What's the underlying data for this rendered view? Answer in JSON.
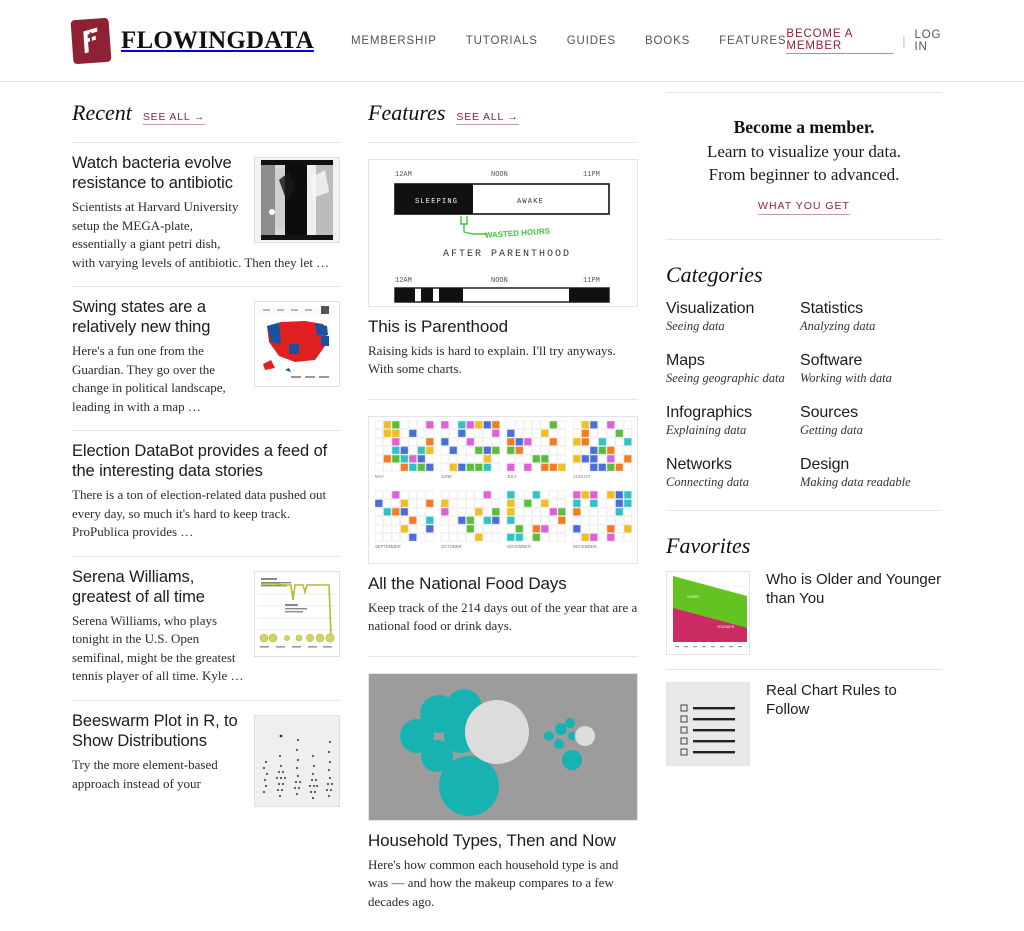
{
  "header": {
    "brand_name": "FLOWINGDATA",
    "logo_icon": "flowingdata-logo-icon",
    "nav": [
      {
        "label": "MEMBERSHIP"
      },
      {
        "label": "TUTORIALS"
      },
      {
        "label": "GUIDES"
      },
      {
        "label": "BOOKS"
      },
      {
        "label": "FEATURES"
      }
    ],
    "become_member": "BECOME A MEMBER",
    "separator": "|",
    "log_in": "LOG IN",
    "accent_color": "#8e2233"
  },
  "recent": {
    "title": "Recent",
    "see_all": "SEE ALL →",
    "posts": [
      {
        "title": "Watch bacteria evolve resistance to antibiotic",
        "excerpt": "Scientists at Harvard University setup the MEGA-plate, essentially a giant petri dish, with varying levels of antibiotic. Then they let …",
        "thumb": "bacteria-petri-photo"
      },
      {
        "title": "Swing states are a relatively new thing",
        "excerpt": "Here's a fun one from the Guardian. They go over the change in political landscape, leading in with a map …",
        "thumb": "us-election-map"
      },
      {
        "title": "Election DataBot provides a feed of the interesting data stories",
        "excerpt": "There is a ton of election-related data pushed out every day, so much it's hard to keep track. ProPublica provides …",
        "thumb": null
      },
      {
        "title": "Serena Williams, greatest of all time",
        "excerpt": "Serena Williams, who plays tonight in the U.S. Open semifinal, might be the greatest tennis player of all time. Kyle …",
        "thumb": "tennis-ranking-line-chart"
      },
      {
        "title": "Beeswarm Plot in R, to Show Distributions",
        "excerpt": "Try the more element-based approach instead of your",
        "thumb": "beeswarm-plot"
      }
    ]
  },
  "features": {
    "title": "Features",
    "see_all": "SEE ALL →",
    "items": [
      {
        "title": "This is Parenthood",
        "excerpt": "Raising kids is hard to explain. I'll try anyways. With some charts.",
        "image": {
          "name": "parenthood-timeline-chart",
          "labels": [
            "12AM",
            "NOON",
            "11PM",
            "SLEEPING",
            "AWAKE",
            "WASTED HOURS",
            "AFTER PARENTHOOD",
            "12AM",
            "NOON",
            "11PM"
          ],
          "annotation_color": "#3ec63e"
        }
      },
      {
        "title": "All the National Food Days",
        "excerpt": "Keep track of the 214 days out of the year that are a national food or drink days.",
        "image": {
          "name": "national-food-days-calendar-heatmap",
          "months": [
            "MAY",
            "JUNE",
            "JULY",
            "AUGUST",
            "SEPTEMBER",
            "OCTOBER",
            "NOVEMBER",
            "DECEMBER"
          ],
          "colors": [
            "#2ec4c6",
            "#f47c20",
            "#5bbd3a",
            "#e060d8",
            "#f0c020",
            "#4a6fd8"
          ]
        }
      },
      {
        "title": "Household Types, Then and Now",
        "excerpt": "Here's how common each household type is and was — and how the makeup compares to a few decades ago.",
        "image": {
          "name": "household-types-bubble-chart",
          "background": "#9c9c9c",
          "colors": [
            "#17b3b3",
            "#dcdcdc"
          ]
        }
      }
    ]
  },
  "sidebar": {
    "promo": {
      "heading": "Become a member.",
      "line1": "Learn to visualize your data.",
      "line2": "From beginner to advanced.",
      "cta": "WHAT YOU GET"
    },
    "categories": {
      "title": "Categories",
      "items": [
        {
          "name": "Visualization",
          "desc": "Seeing data"
        },
        {
          "name": "Statistics",
          "desc": "Analyzing data"
        },
        {
          "name": "Maps",
          "desc": "Seeing geographic data"
        },
        {
          "name": "Software",
          "desc": "Working with data"
        },
        {
          "name": "Infographics",
          "desc": "Explaining data"
        },
        {
          "name": "Sources",
          "desc": "Getting data"
        },
        {
          "name": "Networks",
          "desc": "Connecting data"
        },
        {
          "name": "Design",
          "desc": "Making data readable"
        }
      ]
    },
    "favorites": {
      "title": "Favorites",
      "items": [
        {
          "title": "Who is Older and Younger than You",
          "thumb": "older-younger-area-chart"
        },
        {
          "title": "Real Chart Rules to Follow",
          "thumb": "chart-rules-checklist"
        }
      ]
    }
  },
  "chart_data": [
    {
      "type": "area",
      "name": "older-younger-area-chart",
      "title": "Who is Older and Younger than You",
      "series": [
        {
          "name": "older",
          "color": "#63c321",
          "values": [
            62,
            55,
            47,
            40,
            34,
            29,
            25,
            22,
            20,
            18
          ]
        },
        {
          "name": "younger",
          "color": "#cc2a63",
          "values": [
            38,
            45,
            53,
            60,
            66,
            71,
            75,
            78,
            80,
            82
          ]
        }
      ],
      "xlabel": "",
      "ylabel": "",
      "ylim": [
        0,
        100
      ],
      "grid": true,
      "legend": "inline"
    },
    {
      "type": "heatmap",
      "name": "national-food-days-calendar-heatmap",
      "title": "All the National Food Days",
      "categories": [
        "MAY",
        "JUNE",
        "JULY",
        "AUGUST",
        "SEPTEMBER",
        "OCTOBER",
        "NOVEMBER",
        "DECEMBER"
      ],
      "values": [
        14,
        12,
        22,
        20,
        13,
        19,
        26,
        16
      ],
      "note": "214 days out of the year are a national food or drink day"
    }
  ]
}
